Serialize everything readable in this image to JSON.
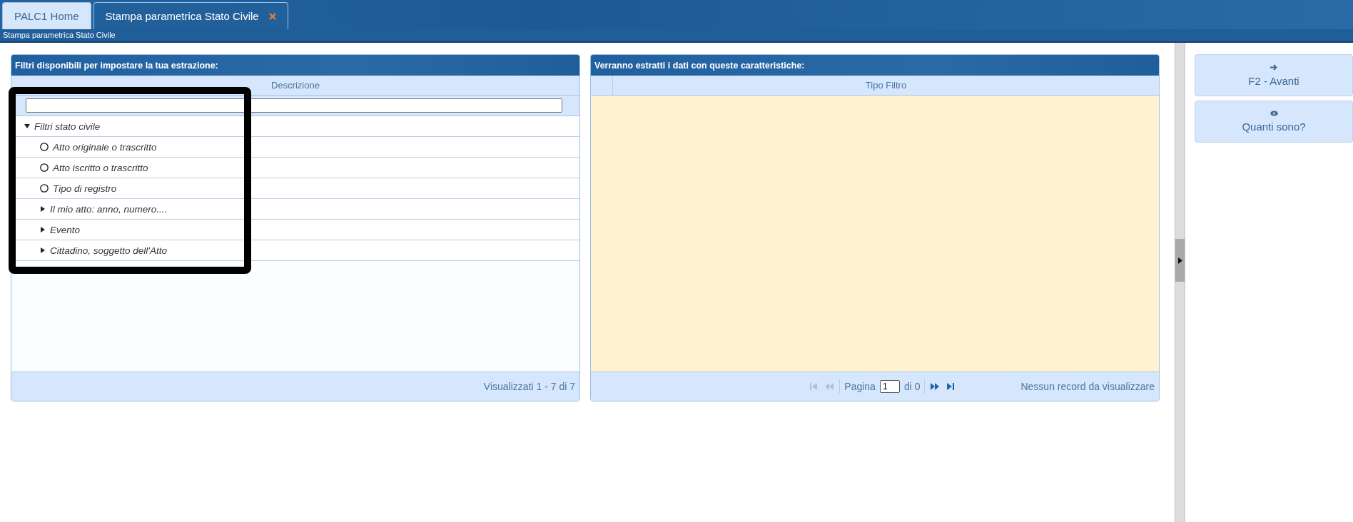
{
  "tabs": [
    {
      "label": "PALC1 Home",
      "selected": false,
      "closable": false
    },
    {
      "label": "Stampa parametrica Stato Civile",
      "selected": true,
      "closable": true
    }
  ],
  "breadcrumb": "Stampa parametrica Stato Civile",
  "filters_panel": {
    "title": "Filtri disponibili per impostare la tua estrazione:",
    "column": "Descrizione",
    "tree": [
      {
        "label": "Filtri stato civile",
        "kind": "group",
        "expanded": true,
        "children": [
          {
            "label": "Atto originale o trascritto",
            "kind": "option"
          },
          {
            "label": "Atto iscritto o trascritto",
            "kind": "option"
          },
          {
            "label": "Tipo di registro",
            "kind": "option"
          },
          {
            "label": "Il mio atto: anno, numero....",
            "kind": "group",
            "expanded": false
          },
          {
            "label": "Evento",
            "kind": "group",
            "expanded": false
          },
          {
            "label": "Cittadino, soggetto dell'Atto",
            "kind": "group",
            "expanded": false
          }
        ]
      }
    ],
    "footer": "Visualizzati 1 - 7 di 7"
  },
  "selection_panel": {
    "title": "Verranno estratti i dati con queste caratteristiche:",
    "column": "Tipo Filtro",
    "pager": {
      "buttons_before": [
        {
          "kind": "first",
          "disabled": true
        },
        {
          "kind": "prev",
          "disabled": true
        }
      ],
      "page_label": "Pagina",
      "page_value": "1",
      "of_label": "di 0",
      "buttons_after": [
        {
          "kind": "next",
          "disabled": false
        },
        {
          "kind": "last",
          "disabled": false
        }
      ]
    },
    "status": "Nessun record da visualizzare"
  },
  "actions": [
    {
      "kind": "next",
      "label": "F2 - Avanti"
    },
    {
      "kind": "count",
      "label": "Quanti sono?"
    }
  ]
}
